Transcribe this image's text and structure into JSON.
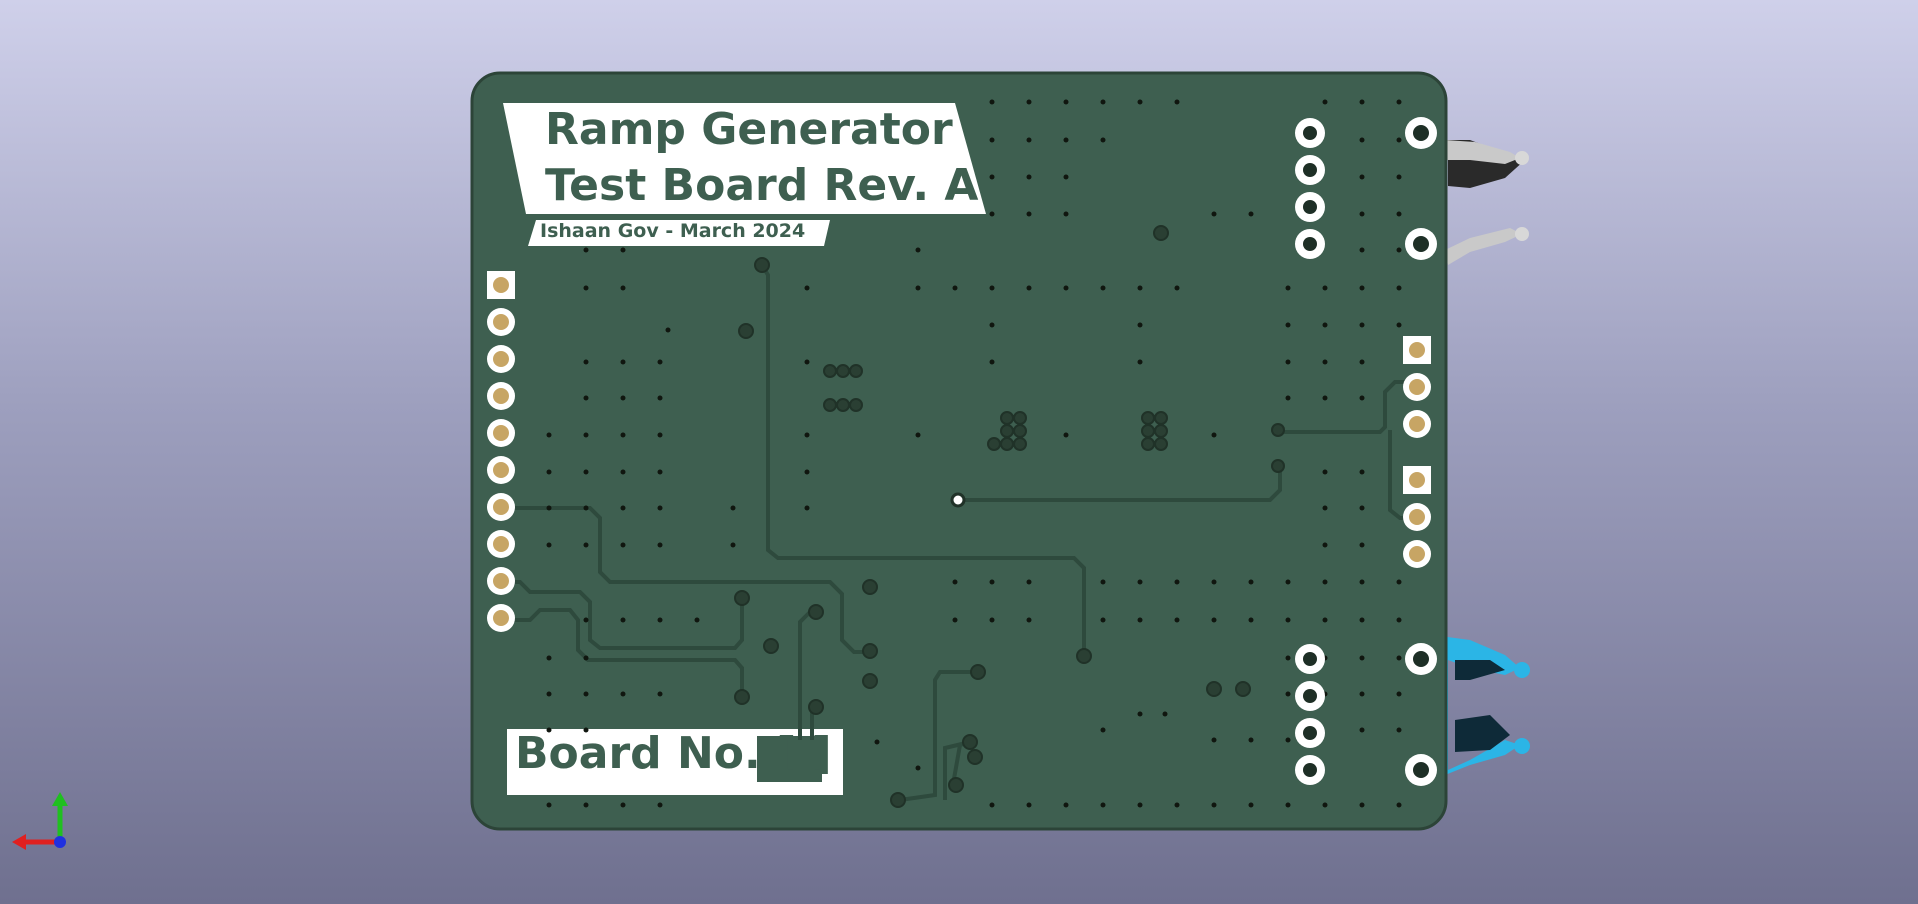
{
  "viewer": {
    "board": {
      "title_line1": "Ramp Generator",
      "title_line2": "Test Board Rev. A",
      "author_line": "Ishaan Gov - March 2024",
      "board_number_label": "Board No. [      ]"
    },
    "colors": {
      "background_top": "#cfd0ea",
      "background_bottom": "#6f708f",
      "pcb": "#3e5f50",
      "silkscreen": "#ffffff",
      "pad_gold": "#c7a564",
      "connector_blue": "#2bb5e6",
      "connector_gray": "#c9c9c9"
    },
    "axis_gizmo": {
      "x_axis_color": "#e02020",
      "y_axis_color": "#20c020",
      "z_axis_color": "#2030e0"
    }
  }
}
